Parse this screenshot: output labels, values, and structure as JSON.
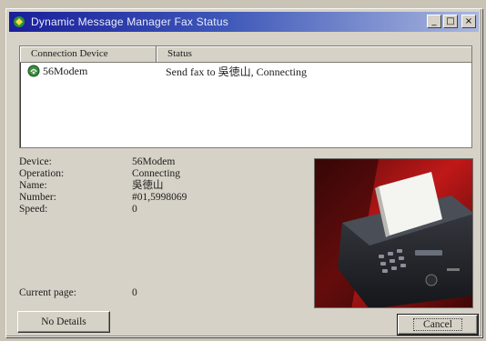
{
  "window": {
    "title": "Dynamic Message Manager Fax Status",
    "buttons": {
      "minimize": "_",
      "maximize": "□",
      "close": "×"
    }
  },
  "list": {
    "columns": [
      "Connection Device",
      "Status"
    ],
    "rows": [
      {
        "device": "56Modem",
        "status": "Send fax to 吳徳山, Connecting",
        "icon": "modem-icon"
      }
    ]
  },
  "details": {
    "device_label": "Device:",
    "device_value": "56Modem",
    "operation_label": "Operation:",
    "operation_value": "Connecting",
    "name_label": "Name:",
    "name_value": "吳徳山",
    "number_label": "Number:",
    "number_value": "#01,5998069",
    "speed_label": "Speed:",
    "speed_value": "0",
    "page_label": "Current page:",
    "page_value": "0"
  },
  "buttons": {
    "no_details": "No Details",
    "cancel": "Cancel"
  },
  "colors": {
    "titlebar_start": "#1a1f9a",
    "titlebar_end": "#a9b7df",
    "face": "#d6d2c7"
  }
}
